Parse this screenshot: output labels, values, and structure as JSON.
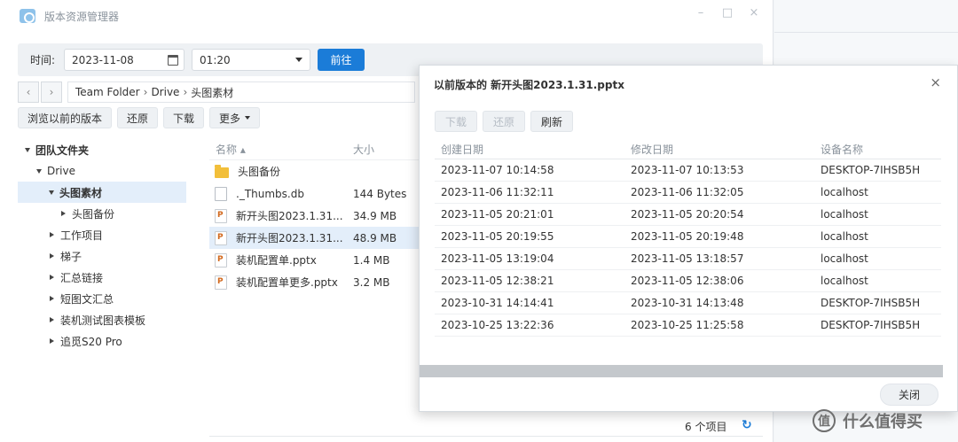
{
  "window": {
    "title": "版本资源管理器",
    "controls": [
      "–",
      "□",
      "×"
    ]
  },
  "timebar": {
    "label": "时间:",
    "date": "2023-11-08",
    "time": "01:20",
    "go_label": "前往"
  },
  "nav": {
    "back": "‹",
    "forward": "›",
    "breadcrumb": [
      "Team Folder",
      "Drive",
      "头图素材"
    ],
    "separator": "›"
  },
  "toolbar": {
    "browse_label": "浏览以前的版本",
    "restore_label": "还原",
    "download_label": "下载",
    "more_label": "更多"
  },
  "tree": {
    "root": "团队文件夹",
    "drive": "Drive",
    "selected": "头图素材",
    "child": "头图备份",
    "others": [
      "工作项目",
      "梯子",
      "汇总链接",
      "短图文汇总",
      "装机测试图表模板",
      "追觅S20 Pro"
    ]
  },
  "filelist": {
    "col_name": "名称 ▴",
    "col_size": "大小",
    "rows": [
      {
        "name": "头图备份",
        "size": ""
      },
      {
        "name": "._Thumbs.db",
        "size": "144 Bytes"
      },
      {
        "name": "新开头图2023.1.31...",
        "size": "34.9 MB"
      },
      {
        "name": "新开头图2023.1.31...",
        "size": "48.9 MB"
      },
      {
        "name": "装机配置单.pptx",
        "size": "1.4 MB"
      },
      {
        "name": "装机配置单更多.pptx",
        "size": "3.2 MB"
      }
    ],
    "status": "6 个项目",
    "refresh": "↻"
  },
  "dialog": {
    "title": "以前版本的 新开头图2023.1.31.pptx",
    "close": "×",
    "download_label": "下载",
    "restore_label": "还原",
    "refresh_label": "刷新",
    "col_created": "创建日期",
    "col_modified": "修改日期",
    "col_device": "设备名称",
    "rows": [
      {
        "created": "2023-11-07 10:14:58",
        "modified": "2023-11-07 10:13:53",
        "device": "DESKTOP-7IHSB5H"
      },
      {
        "created": "2023-11-06 11:32:11",
        "modified": "2023-11-06 11:32:05",
        "device": "localhost"
      },
      {
        "created": "2023-11-05 20:21:01",
        "modified": "2023-11-05 20:20:54",
        "device": "localhost"
      },
      {
        "created": "2023-11-05 20:19:55",
        "modified": "2023-11-05 20:19:48",
        "device": "localhost"
      },
      {
        "created": "2023-11-05 13:19:04",
        "modified": "2023-11-05 13:18:57",
        "device": "localhost"
      },
      {
        "created": "2023-11-05 12:38:21",
        "modified": "2023-11-05 12:38:06",
        "device": "localhost"
      },
      {
        "created": "2023-10-31 14:14:41",
        "modified": "2023-10-31 14:13:48",
        "device": "DESKTOP-7IHSB5H"
      },
      {
        "created": "2023-10-25 13:22:36",
        "modified": "2023-10-25 11:25:58",
        "device": "DESKTOP-7IHSB5H"
      }
    ],
    "ok_label": "关闭"
  },
  "watermark": {
    "badge": "值",
    "text": "什么值得买"
  },
  "colors": {
    "accent": "#1b7cd8",
    "selection": "#e3eefa",
    "folder": "#f2bf3a"
  }
}
